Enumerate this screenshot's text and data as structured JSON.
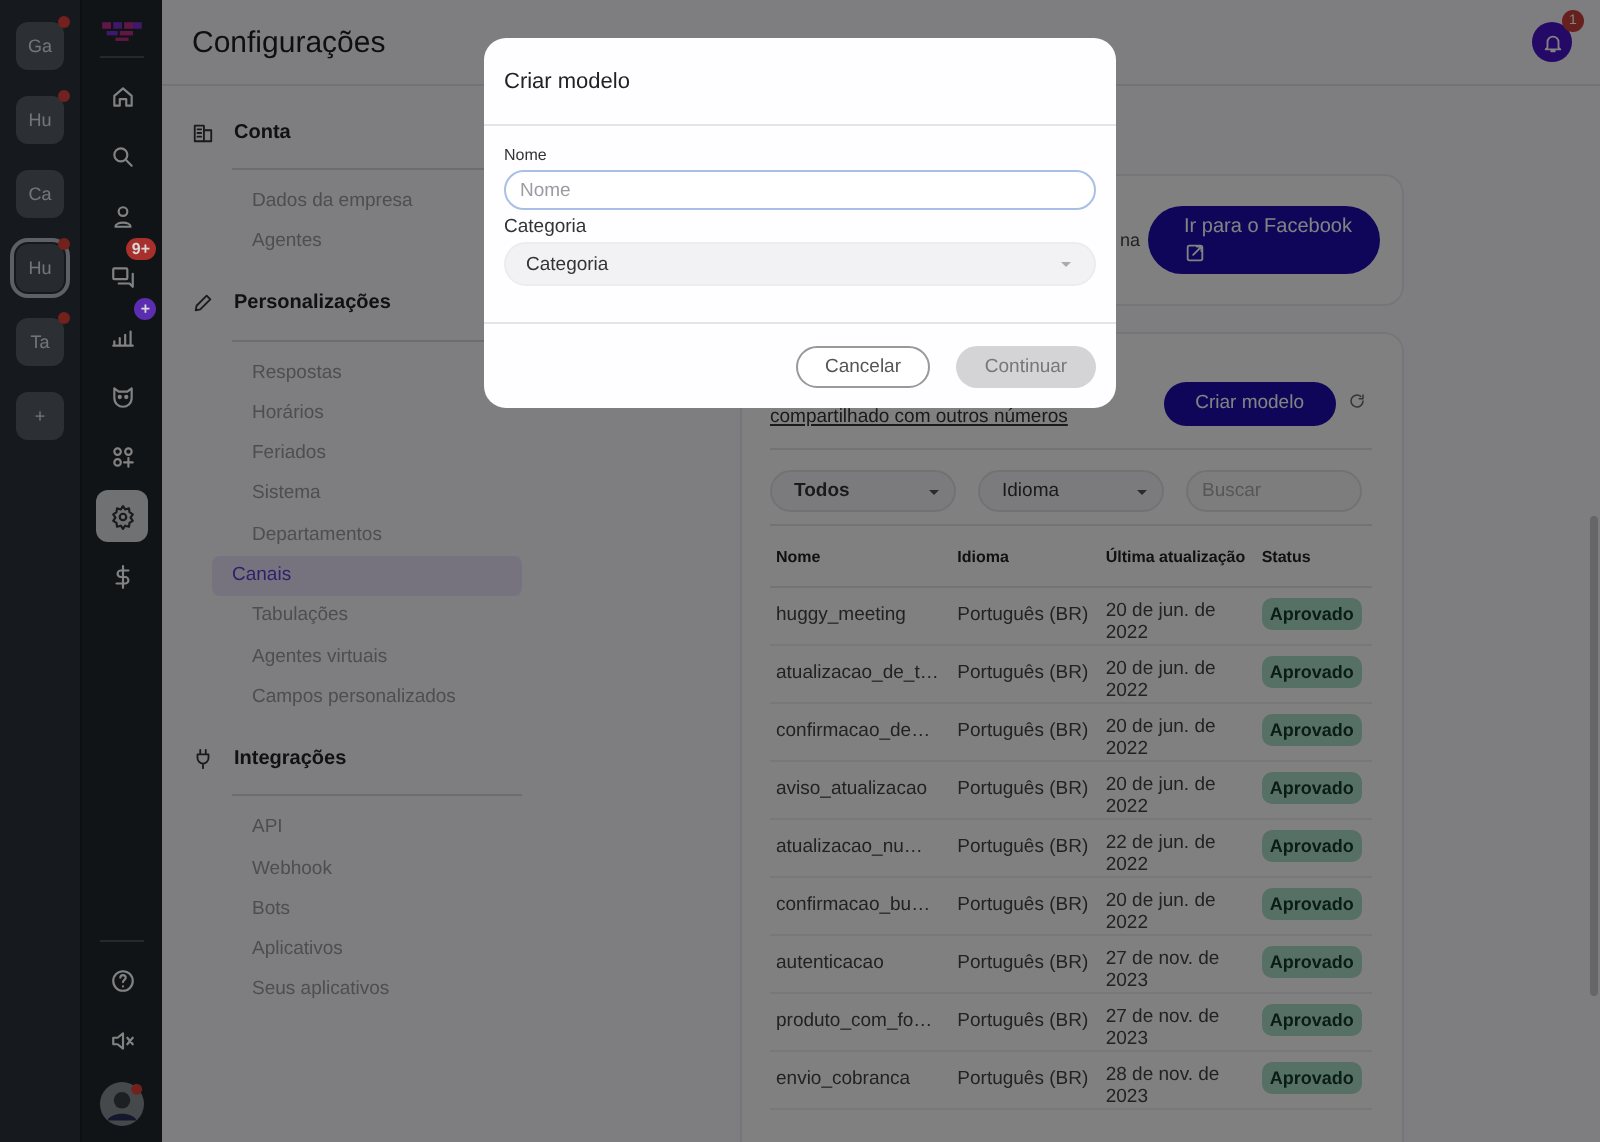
{
  "workspaces": [
    {
      "label": "Ga",
      "dot": true,
      "selected": false
    },
    {
      "label": "Hu",
      "dot": true,
      "selected": false
    },
    {
      "label": "Ca",
      "dot": false,
      "selected": false
    },
    {
      "label": "Hu",
      "dot": true,
      "selected": true
    },
    {
      "label": "Ta",
      "dot": true,
      "selected": false
    },
    {
      "label": "+",
      "dot": false,
      "selected": false
    }
  ],
  "nav": {
    "items": [
      {
        "kind": "home",
        "selected": false
      },
      {
        "kind": "search",
        "selected": false
      },
      {
        "kind": "person",
        "selected": false
      },
      {
        "kind": "chat",
        "selected": false,
        "badge": {
          "text": "9+",
          "color": "#a8302c"
        }
      },
      {
        "kind": "chart",
        "selected": false,
        "badge": {
          "text": "+",
          "color": "#5b2db0"
        }
      },
      {
        "kind": "mask",
        "selected": false
      },
      {
        "kind": "apps",
        "selected": false
      },
      {
        "kind": "settings",
        "selected": true
      },
      {
        "kind": "dollar",
        "selected": false
      }
    ],
    "bottom": [
      {
        "kind": "help"
      },
      {
        "kind": "mute"
      },
      {
        "kind": "avatar"
      }
    ]
  },
  "header": {
    "title": "Configurações",
    "notifications": "1"
  },
  "settings_menu": [
    {
      "kind": "building",
      "title": "Conta",
      "items": [
        {
          "label": "Dados da empresa",
          "selected": false
        },
        {
          "label": "Agentes",
          "selected": false
        }
      ]
    },
    {
      "kind": "pencil",
      "title": "Personalizações",
      "items": [
        {
          "label": "Respostas",
          "selected": false
        },
        {
          "label": "Horários",
          "selected": false
        },
        {
          "label": "Feriados",
          "selected": false
        },
        {
          "label": "Sistema",
          "selected": false
        },
        {
          "label": "Departamentos",
          "selected": false
        },
        {
          "label": "Canais",
          "selected": true
        },
        {
          "label": "Tabulações",
          "selected": false
        },
        {
          "label": "Agentes virtuais",
          "selected": false
        },
        {
          "label": "Campos personalizados",
          "selected": false
        }
      ]
    },
    {
      "kind": "plug",
      "title": "Integrações",
      "items": [
        {
          "label": "API",
          "selected": false
        },
        {
          "label": "Webhook",
          "selected": false
        },
        {
          "label": "Bots",
          "selected": false
        },
        {
          "label": "Aplicativos",
          "selected": false
        },
        {
          "label": "Seus aplicativos",
          "selected": false
        }
      ]
    }
  ],
  "facebook_card": {
    "text": "na",
    "button": "Ir para o Facebook"
  },
  "templates_card": {
    "link": "compartilhado com outros números",
    "button": "Criar modelo",
    "filters": {
      "status": "Todos",
      "language": "Idioma",
      "search_placeholder": "Buscar"
    },
    "table": {
      "columns": [
        "Nome",
        "Idioma",
        "Última atualização",
        "Status"
      ],
      "rows": [
        [
          "huggy_meeting",
          "Português (BR)",
          "20 de jun. de 2022",
          "Aprovado"
        ],
        [
          "atualizacao_de_t…",
          "Português (BR)",
          "20 de jun. de 2022",
          "Aprovado"
        ],
        [
          "confirmacao_de…",
          "Português (BR)",
          "20 de jun. de 2022",
          "Aprovado"
        ],
        [
          "aviso_atualizacao",
          "Português (BR)",
          "20 de jun. de 2022",
          "Aprovado"
        ],
        [
          "atualizacao_nu…",
          "Português (BR)",
          "22 de jun. de 2022",
          "Aprovado"
        ],
        [
          "confirmacao_bu…",
          "Português (BR)",
          "20 de jun. de 2022",
          "Aprovado"
        ],
        [
          "autenticacao",
          "Português (BR)",
          "27 de nov. de 2023",
          "Aprovado"
        ],
        [
          "produto_com_fo…",
          "Português (BR)",
          "27 de nov. de 2023",
          "Aprovado"
        ],
        [
          "envio_cobranca",
          "Português (BR)",
          "28 de nov. de 2023",
          "Aprovado"
        ]
      ]
    }
  },
  "modal": {
    "title": "Criar modelo",
    "name_label": "Nome",
    "name_placeholder": "Nome",
    "category_label": "Categoria",
    "category_value": "Categoria",
    "cancel": "Cancelar",
    "continue": "Continuar",
    "continue_disabled": true
  }
}
